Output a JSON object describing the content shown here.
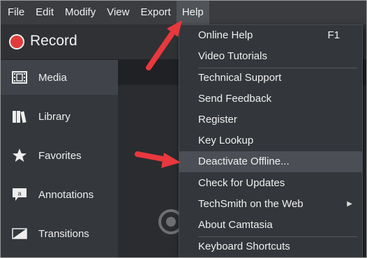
{
  "menubar": {
    "items": [
      {
        "label": "File"
      },
      {
        "label": "Edit"
      },
      {
        "label": "Modify"
      },
      {
        "label": "View"
      },
      {
        "label": "Export"
      },
      {
        "label": "Help"
      }
    ],
    "active": "Help"
  },
  "record": {
    "label": "Record"
  },
  "sidebar": {
    "items": [
      {
        "label": "Media",
        "icon": "film-icon"
      },
      {
        "label": "Library",
        "icon": "library-books-icon"
      },
      {
        "label": "Favorites",
        "icon": "star-icon"
      },
      {
        "label": "Annotations",
        "icon": "speech-bubble-icon"
      },
      {
        "label": "Transitions",
        "icon": "transition-icon"
      }
    ]
  },
  "help_menu": {
    "items": [
      {
        "label": "Online Help",
        "shortcut": "F1"
      },
      {
        "label": "Video Tutorials"
      },
      {
        "label": "Technical Support"
      },
      {
        "label": "Send Feedback"
      },
      {
        "label": "Register"
      },
      {
        "label": "Key Lookup"
      },
      {
        "label": "Deactivate Offline..."
      },
      {
        "label": "Check for Updates"
      },
      {
        "label": "TechSmith on the Web",
        "submenu": true
      },
      {
        "label": "About Camtasia"
      },
      {
        "label": "Keyboard Shortcuts"
      }
    ],
    "highlighted": "Deactivate Offline..."
  },
  "colors": {
    "arrow": "#e8383d",
    "record_dot": "#e23b3b"
  }
}
